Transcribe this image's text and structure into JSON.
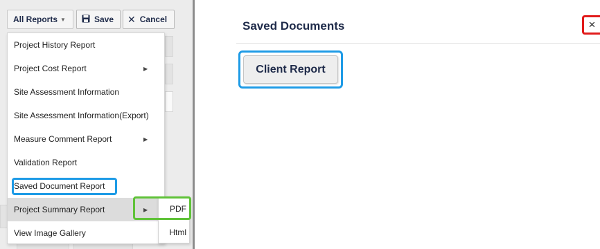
{
  "toolbar": {
    "all_reports_label": "All Reports",
    "save_label": "Save",
    "cancel_label": "Cancel",
    "save_icon": "floppy-disk-icon",
    "cancel_icon": "close-icon"
  },
  "menu": {
    "items": [
      {
        "label": "Project History Report"
      },
      {
        "label": "Project Cost Report"
      },
      {
        "label": "Site Assessment Information"
      },
      {
        "label": "Site Assessment Information(Export)"
      },
      {
        "label": "Measure Comment Report"
      },
      {
        "label": "Validation Report"
      },
      {
        "label": "Saved Document Report"
      },
      {
        "label": "Project Summary Report"
      },
      {
        "label": "View Image Gallery"
      }
    ],
    "submenu": [
      {
        "label": "PDF"
      },
      {
        "label": "Html"
      }
    ]
  },
  "panel": {
    "title": "Saved Documents",
    "close_glyph": "×",
    "document_button_label": "Client Report"
  },
  "colors": {
    "highlight_blue": "#1e9be6",
    "highlight_green": "#5fc238",
    "highlight_red": "#e11b1b",
    "title_navy": "#1f2b4a"
  }
}
